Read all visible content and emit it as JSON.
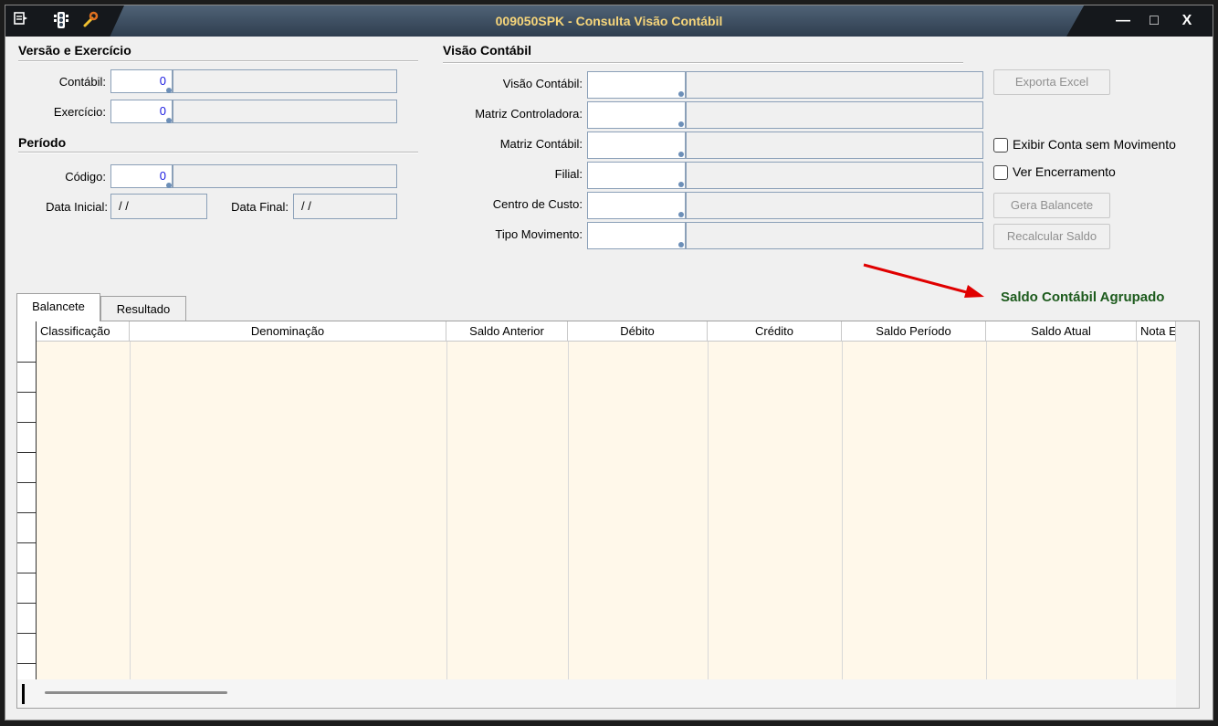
{
  "window": {
    "title": "009050SPK - Consulta Visão Contábil",
    "icons": [
      "menu-icon",
      "traffic-light-icon",
      "wrench-icon"
    ],
    "controls": {
      "minimize": "—",
      "maximize": "□",
      "close": "X"
    }
  },
  "versao_exercicio": {
    "title": "Versão e Exercício",
    "contabil_label": "Contábil:",
    "contabil_value": "0",
    "exercicio_label": "Exercício:",
    "exercicio_value": "0"
  },
  "periodo": {
    "title": "Período",
    "codigo_label": "Código:",
    "codigo_value": "0",
    "data_inicial_label": "Data Inicial:",
    "data_inicial_value": "/ /",
    "data_final_label": "Data Final:",
    "data_final_value": "/ /"
  },
  "visao_contabil": {
    "title": "Visão Contábil",
    "fields": [
      {
        "label": "Visão Contábil:"
      },
      {
        "label": "Matriz Controladora:"
      },
      {
        "label": "Matriz Contábil:"
      },
      {
        "label": "Filial:"
      },
      {
        "label": "Centro de Custo:"
      },
      {
        "label": "Tipo Movimento:"
      }
    ]
  },
  "actions": {
    "exporta_excel": "Exporta Excel",
    "gera_balancete": "Gera Balancete",
    "recalcular_saldo": "Recalcular Saldo",
    "exibir_conta_label": "Exibir Conta sem Movimento",
    "exibir_conta_checked": false,
    "ver_encerramento_label": "Ver Encerramento",
    "ver_encerramento_checked": false
  },
  "saldo_agrupado": "Saldo Contábil Agrupado",
  "tabs": [
    "Balancete",
    "Resultado"
  ],
  "active_tab": "Balancete",
  "grid": {
    "columns": [
      "Classificação",
      "Denominação",
      "Saldo Anterior",
      "Débito",
      "Crédito",
      "Saldo Período",
      "Saldo Atual",
      "Nota E"
    ]
  },
  "colors": {
    "accent_title": "#f6d57a",
    "saldo_green": "#1d5b1d",
    "grid_bg": "#fff8ea",
    "arrow_red": "#e00000"
  }
}
